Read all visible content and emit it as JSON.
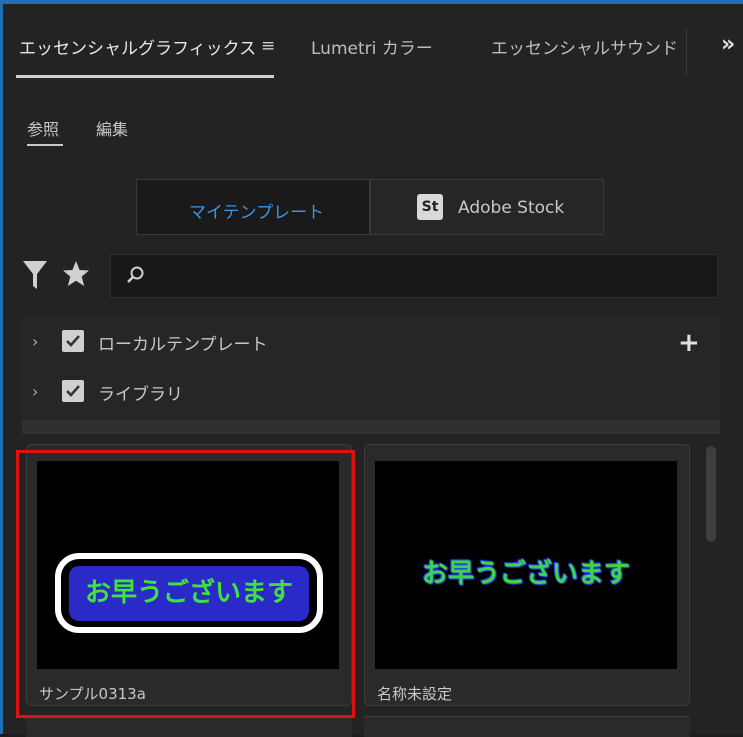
{
  "tabs": [
    {
      "label": "エッセンシャルグラフィックス",
      "active": true
    },
    {
      "label": "Lumetri カラー",
      "active": false
    },
    {
      "label": "エッセンシャルサウンド",
      "active": false
    }
  ],
  "tab_menu_glyph": "≡",
  "tab_more_glyph": "»",
  "subtabs": [
    {
      "label": "参照",
      "active": true
    },
    {
      "label": "編集",
      "active": false
    }
  ],
  "source_toggle": {
    "my_templates": "マイテンプレート",
    "adobe_stock": "Adobe Stock",
    "adobe_stock_badge": "St",
    "selected": "my_templates"
  },
  "search": {
    "value": "",
    "placeholder": ""
  },
  "tree": [
    {
      "label": "ローカルテンプレート",
      "checked": true
    },
    {
      "label": "ライブラリ",
      "checked": true
    }
  ],
  "add_glyph": "+",
  "templates": [
    {
      "name": "サンプル0313a",
      "preview_text": "お早うございます",
      "selected": true
    },
    {
      "name": "名称未設定",
      "preview_text": "お早うございます",
      "selected": false
    }
  ],
  "colors": {
    "accent_blue": "#3d93e6",
    "selection_red": "#e01010",
    "preview_green": "#3fe23f",
    "preview_blue": "#2a2ac8"
  }
}
